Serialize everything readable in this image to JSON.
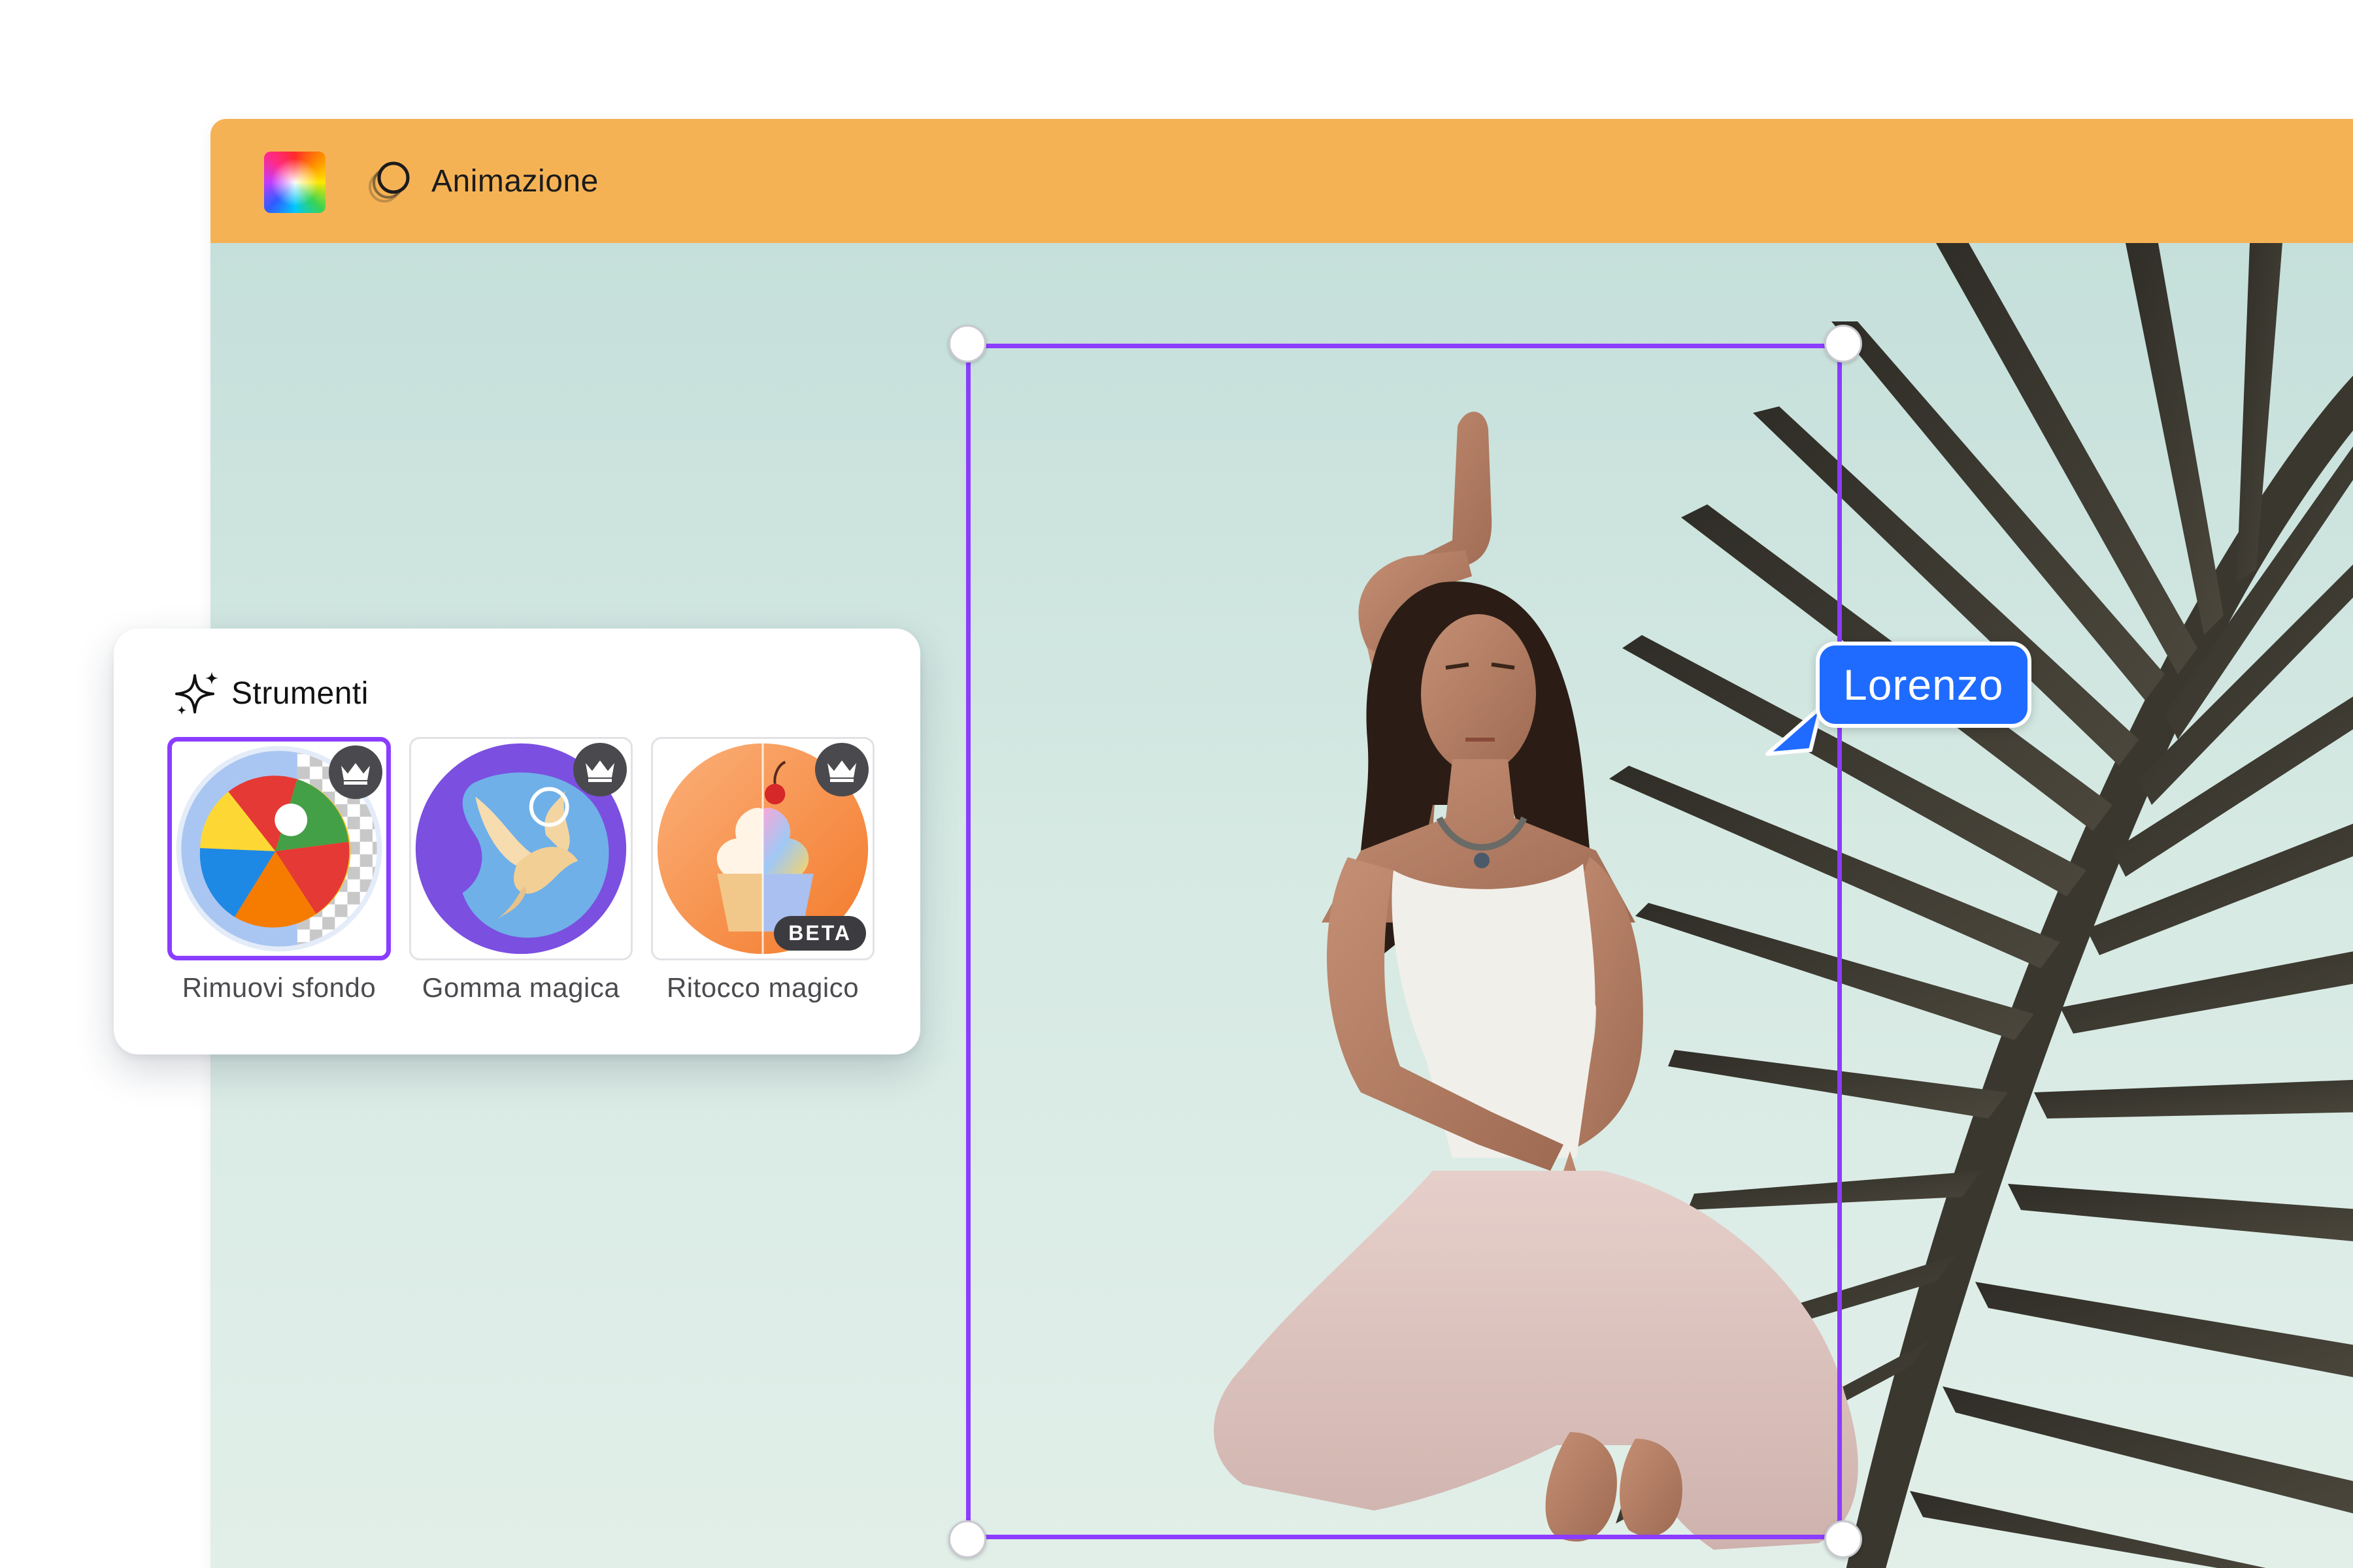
{
  "toolbar": {
    "palette_icon": "color-palette-icon",
    "animation_icon": "animation-circles-icon",
    "animation_label": "Animazione"
  },
  "canvas": {
    "subject": "woman-yoga-pose-photo",
    "background_color": "#c9e1db"
  },
  "selection": {
    "color": "#8b3dff"
  },
  "collaborator": {
    "name": "Lorenzo",
    "color": "#1f6bff"
  },
  "tools_panel": {
    "title": "Strumenti",
    "icon": "sparkle-icon",
    "tools": [
      {
        "label": "Rimuovi sfondo",
        "badge_icon": "crown-icon",
        "selected": true,
        "beta": ""
      },
      {
        "label": "Gomma magica",
        "badge_icon": "crown-icon",
        "selected": false,
        "beta": ""
      },
      {
        "label": "Ritocco magico",
        "badge_icon": "crown-icon",
        "selected": false,
        "beta": "BETA"
      }
    ]
  }
}
